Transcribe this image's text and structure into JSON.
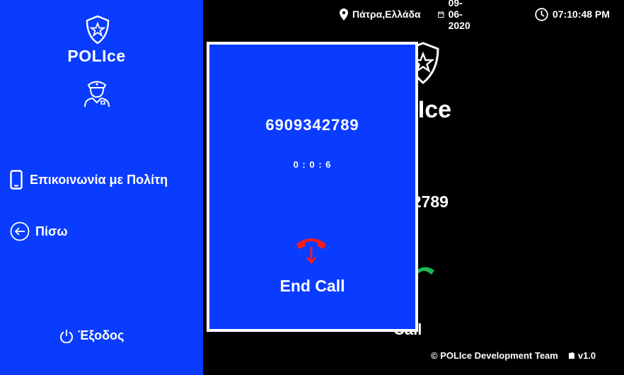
{
  "sidebar": {
    "title": "POLIce",
    "nav": [
      {
        "label": "Επικοινωνία με Πολίτη",
        "icon": "smartphone-icon"
      },
      {
        "label": "Πίσω",
        "icon": "arrow-left-circle-icon"
      }
    ],
    "exit_label": "Έξοδος"
  },
  "topbar": {
    "location": "Πάτρα,Ελλάδα",
    "date": "09-06-2020",
    "time": "07:10:48 PM"
  },
  "background": {
    "title": "LIce",
    "number": "42789",
    "call_label": "Call"
  },
  "call_modal": {
    "number": "6909342789",
    "timer": "0 : 0 : 6",
    "end_label": "End Call"
  },
  "footer": {
    "team": "© POLIce Development Team",
    "version": "v1.0"
  },
  "colors": {
    "primary_blue": "#0a3cff",
    "background": "#000000",
    "end_call_red": "#ff1a1a",
    "call_green": "#1db954"
  }
}
